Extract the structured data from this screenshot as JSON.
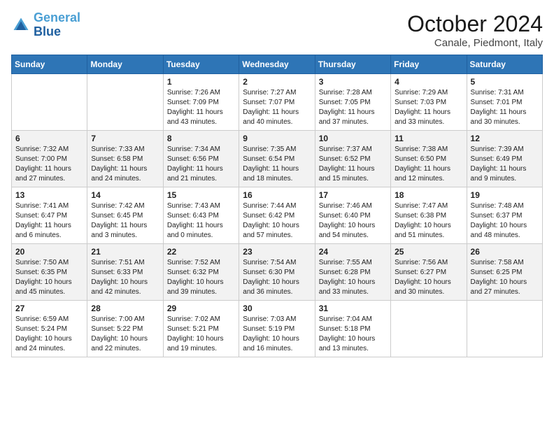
{
  "header": {
    "logo_line1": "General",
    "logo_line2": "Blue",
    "month": "October 2024",
    "location": "Canale, Piedmont, Italy"
  },
  "days_of_week": [
    "Sunday",
    "Monday",
    "Tuesday",
    "Wednesday",
    "Thursday",
    "Friday",
    "Saturday"
  ],
  "weeks": [
    [
      {
        "day": "",
        "info": ""
      },
      {
        "day": "",
        "info": ""
      },
      {
        "day": "1",
        "info": "Sunrise: 7:26 AM\nSunset: 7:09 PM\nDaylight: 11 hours and 43 minutes."
      },
      {
        "day": "2",
        "info": "Sunrise: 7:27 AM\nSunset: 7:07 PM\nDaylight: 11 hours and 40 minutes."
      },
      {
        "day": "3",
        "info": "Sunrise: 7:28 AM\nSunset: 7:05 PM\nDaylight: 11 hours and 37 minutes."
      },
      {
        "day": "4",
        "info": "Sunrise: 7:29 AM\nSunset: 7:03 PM\nDaylight: 11 hours and 33 minutes."
      },
      {
        "day": "5",
        "info": "Sunrise: 7:31 AM\nSunset: 7:01 PM\nDaylight: 11 hours and 30 minutes."
      }
    ],
    [
      {
        "day": "6",
        "info": "Sunrise: 7:32 AM\nSunset: 7:00 PM\nDaylight: 11 hours and 27 minutes."
      },
      {
        "day": "7",
        "info": "Sunrise: 7:33 AM\nSunset: 6:58 PM\nDaylight: 11 hours and 24 minutes."
      },
      {
        "day": "8",
        "info": "Sunrise: 7:34 AM\nSunset: 6:56 PM\nDaylight: 11 hours and 21 minutes."
      },
      {
        "day": "9",
        "info": "Sunrise: 7:35 AM\nSunset: 6:54 PM\nDaylight: 11 hours and 18 minutes."
      },
      {
        "day": "10",
        "info": "Sunrise: 7:37 AM\nSunset: 6:52 PM\nDaylight: 11 hours and 15 minutes."
      },
      {
        "day": "11",
        "info": "Sunrise: 7:38 AM\nSunset: 6:50 PM\nDaylight: 11 hours and 12 minutes."
      },
      {
        "day": "12",
        "info": "Sunrise: 7:39 AM\nSunset: 6:49 PM\nDaylight: 11 hours and 9 minutes."
      }
    ],
    [
      {
        "day": "13",
        "info": "Sunrise: 7:41 AM\nSunset: 6:47 PM\nDaylight: 11 hours and 6 minutes."
      },
      {
        "day": "14",
        "info": "Sunrise: 7:42 AM\nSunset: 6:45 PM\nDaylight: 11 hours and 3 minutes."
      },
      {
        "day": "15",
        "info": "Sunrise: 7:43 AM\nSunset: 6:43 PM\nDaylight: 11 hours and 0 minutes."
      },
      {
        "day": "16",
        "info": "Sunrise: 7:44 AM\nSunset: 6:42 PM\nDaylight: 10 hours and 57 minutes."
      },
      {
        "day": "17",
        "info": "Sunrise: 7:46 AM\nSunset: 6:40 PM\nDaylight: 10 hours and 54 minutes."
      },
      {
        "day": "18",
        "info": "Sunrise: 7:47 AM\nSunset: 6:38 PM\nDaylight: 10 hours and 51 minutes."
      },
      {
        "day": "19",
        "info": "Sunrise: 7:48 AM\nSunset: 6:37 PM\nDaylight: 10 hours and 48 minutes."
      }
    ],
    [
      {
        "day": "20",
        "info": "Sunrise: 7:50 AM\nSunset: 6:35 PM\nDaylight: 10 hours and 45 minutes."
      },
      {
        "day": "21",
        "info": "Sunrise: 7:51 AM\nSunset: 6:33 PM\nDaylight: 10 hours and 42 minutes."
      },
      {
        "day": "22",
        "info": "Sunrise: 7:52 AM\nSunset: 6:32 PM\nDaylight: 10 hours and 39 minutes."
      },
      {
        "day": "23",
        "info": "Sunrise: 7:54 AM\nSunset: 6:30 PM\nDaylight: 10 hours and 36 minutes."
      },
      {
        "day": "24",
        "info": "Sunrise: 7:55 AM\nSunset: 6:28 PM\nDaylight: 10 hours and 33 minutes."
      },
      {
        "day": "25",
        "info": "Sunrise: 7:56 AM\nSunset: 6:27 PM\nDaylight: 10 hours and 30 minutes."
      },
      {
        "day": "26",
        "info": "Sunrise: 7:58 AM\nSunset: 6:25 PM\nDaylight: 10 hours and 27 minutes."
      }
    ],
    [
      {
        "day": "27",
        "info": "Sunrise: 6:59 AM\nSunset: 5:24 PM\nDaylight: 10 hours and 24 minutes."
      },
      {
        "day": "28",
        "info": "Sunrise: 7:00 AM\nSunset: 5:22 PM\nDaylight: 10 hours and 22 minutes."
      },
      {
        "day": "29",
        "info": "Sunrise: 7:02 AM\nSunset: 5:21 PM\nDaylight: 10 hours and 19 minutes."
      },
      {
        "day": "30",
        "info": "Sunrise: 7:03 AM\nSunset: 5:19 PM\nDaylight: 10 hours and 16 minutes."
      },
      {
        "day": "31",
        "info": "Sunrise: 7:04 AM\nSunset: 5:18 PM\nDaylight: 10 hours and 13 minutes."
      },
      {
        "day": "",
        "info": ""
      },
      {
        "day": "",
        "info": ""
      }
    ]
  ]
}
